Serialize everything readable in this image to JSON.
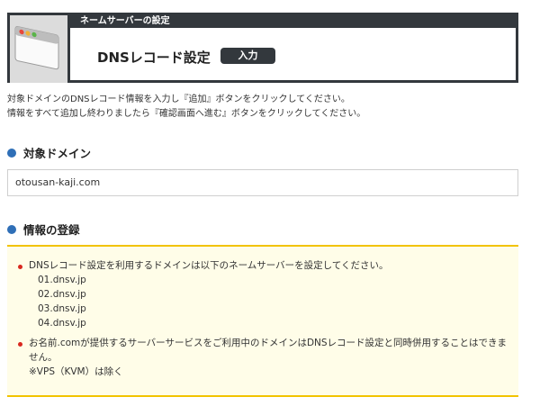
{
  "header": {
    "strip_label": "ネームサーバーの設定",
    "title": "DNSレコード設定",
    "badge": "入力"
  },
  "intro": {
    "line1": "対象ドメインのDNSレコード情報を入力し『追加』ボタンをクリックしてください。",
    "line2": "情報をすべて追加し終わりましたら『確認画面へ進む』ボタンをクリックしてください。"
  },
  "sections": {
    "domain": {
      "heading": "対象ドメイン",
      "value": "otousan-kaji.com"
    },
    "registration": {
      "heading": "情報の登録"
    }
  },
  "notice": {
    "item1": {
      "text": "DNSレコード設定を利用するドメインは以下のネームサーバーを設定してください。",
      "servers": [
        "01.dnsv.jp",
        "02.dnsv.jp",
        "03.dnsv.jp",
        "04.dnsv.jp"
      ]
    },
    "item2": {
      "line1": "お名前.comが提供するサーバーサービスをご利用中のドメインはDNSレコード設定と同時併用することはできま",
      "line2": "せん。",
      "line3": "※VPS（KVM）は除く"
    }
  },
  "colors": {
    "accent_blue": "#2f6fb7",
    "dark": "#33383d",
    "notice_border": "#f2c300",
    "bullet_red": "#d9281f"
  }
}
